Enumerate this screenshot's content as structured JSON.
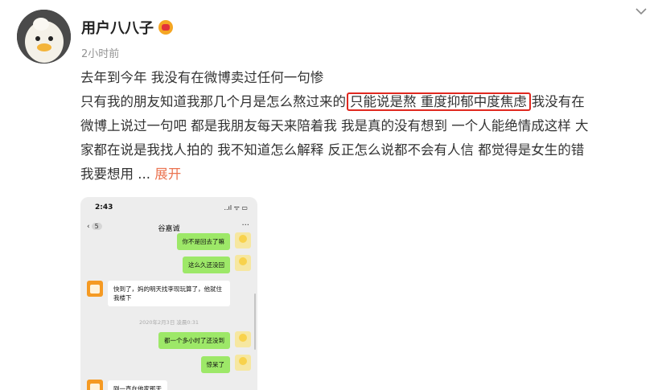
{
  "user": {
    "name": "用户八八子",
    "badge_icon": "vip-crown-icon",
    "time": "2小时前"
  },
  "post": {
    "lines": [
      "去年到今年 我没有在微博卖过任何一句惨",
      "只有我的朋友知道我那几个月是怎么熬过来的",
      "只能说是熬 重度抑郁中度焦虑",
      "我没有在",
      "微博上说过一句吧 都是我朋友每天来陪着我 我是真的没有想到 一个人能绝情成这样 大",
      "家都在说是我找人拍的 我不知道怎么解释 反正怎么说都不会有人信 都觉得是女生的错",
      "我要想用 ... "
    ],
    "expand": "展开",
    "highlight_color": "#e0281f",
    "expand_color": "#eb7350"
  },
  "screenshot": {
    "status_time": "2:43",
    "status_icons": "..ıl ᯤ ▭",
    "back_count": "5",
    "chat_title": "谷嘉诚",
    "more": "···",
    "messages": [
      {
        "side": "right",
        "text": "你不是回去了嘛"
      },
      {
        "side": "right",
        "text": "这么久还没回"
      },
      {
        "side": "left",
        "text": "快到了，妈的明天找李现玩算了，他就住我楼下"
      },
      {
        "side": "right",
        "text": "都一个多小时了还没到"
      },
      {
        "side": "right",
        "text": "惊呆了"
      },
      {
        "side": "left",
        "text": "刚一直在他家那天"
      }
    ],
    "date_stamp": "2020年2月3日 凌晨0:31"
  }
}
